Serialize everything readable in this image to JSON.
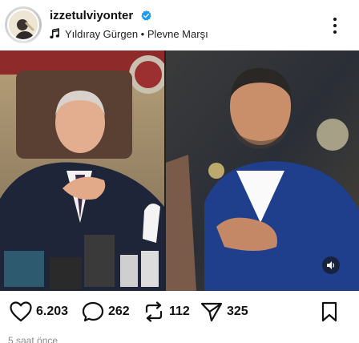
{
  "post": {
    "username": "izzetulviyonter",
    "verified": true,
    "music": "Yıldıray Gürgen • Plevne Marşı",
    "timestamp": "5 saat önce"
  },
  "stats": {
    "likes": "6.203",
    "comments": "262",
    "reposts": "112",
    "shares": "325"
  },
  "icons": {
    "avatar": "avatar-image",
    "verified": "verified-badge-icon",
    "music": "music-note-icon",
    "more": "more-options-icon",
    "like": "heart-icon",
    "comment": "comment-bubble-icon",
    "repost": "repost-icon",
    "share": "send-icon",
    "bookmark": "bookmark-icon",
    "mute": "speaker-icon"
  },
  "colors": {
    "verified_blue": "#1d9bf0",
    "text": "#111111",
    "muted_text": "#8a8a8a"
  }
}
